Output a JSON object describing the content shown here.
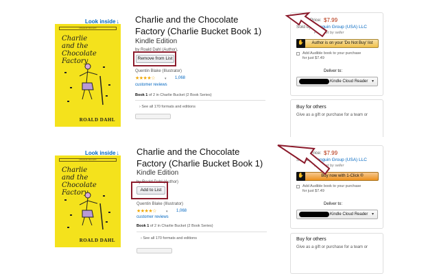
{
  "panels": [
    {
      "look_inside": "Look inside",
      "cover": {
        "band": "CHARLIE BUCKET",
        "title_lines": [
          "Charlie",
          "and the",
          "Chocolate",
          "Factory"
        ],
        "author": "ROALD DAHL"
      },
      "title_line1": "Charlie and the Chocolate",
      "title_line2": "Factory (Charlie Bucket Book 1)",
      "edition": "Kindle Edition",
      "byline": "by Roald Dahl (Author),",
      "list_button": "Remove from List",
      "illustrator": "Quentin Blake (Illustrator)",
      "stars": "★★★★☆",
      "ratings_count": "1,068",
      "reviews_label": "customer reviews",
      "series_bold": "Book 1",
      "series_rest": "of 2 in Charlie Bucket (2 Book Series)",
      "see_all": "See all 170 formats and editions",
      "buybox": {
        "price_label": "Kindle Price:",
        "price": "$7.99",
        "sold_by_label": "Sold by:",
        "seller": "Penguin Group (USA) LLC",
        "priced_by": "Price set by seller",
        "button": "Author is on your 'Do Not Buy' list",
        "audible": "Add Audible book to your purchase",
        "audible_price": "for just $7.49",
        "deliver_to": "Deliver to:",
        "device": "Kindle Cloud Reader"
      },
      "others_title": "Buy for others",
      "others_sub": "Give as a gift or purchase for a team or"
    },
    {
      "look_inside": "Look inside",
      "cover": {
        "band": "CHARLIE BUCKET",
        "title_lines": [
          "Charlie",
          "and the",
          "Chocolate",
          "Factory"
        ],
        "author": "ROALD DAHL"
      },
      "title_line1": "Charlie and the Chocolate",
      "title_line2": "Factory (Charlie Bucket Book 1)",
      "edition": "Kindle Edition",
      "byline": "by Roald Dahl (Author)",
      "list_button": "Add to List",
      "illustrator": "Quentin Blake (Illustrator)",
      "stars": "★★★★☆",
      "ratings_count": "1,068",
      "reviews_label": "customer reviews",
      "series_bold": "Book 1",
      "series_rest": "of 2 in Charlie Bucket (2 Book Series)",
      "see_all": "See all 170 formats and editions",
      "buybox": {
        "price_label": "Kindle Price:",
        "price": "$7.99",
        "sold_by_label": "Sold by:",
        "seller": "Penguin Group (USA) LLC",
        "priced_by": "Price set by seller",
        "button": "Buy now with 1-Click ®",
        "audible": "Add Audible book to your purchase",
        "audible_price": "for just $7.49",
        "deliver_to": "Deliver to:",
        "device": "Kindle Cloud Reader"
      },
      "others_title": "Buy for others",
      "others_sub": "Give as a gift or purchase for a team or"
    }
  ],
  "colors": {
    "cover": "#f4e21c",
    "highlight_box": "#8b1a2b",
    "link": "#0066c0",
    "price": "#b12704",
    "star": "#f0a600"
  },
  "icons": [
    "look-inside-arrow-icon",
    "hand-cursor-icon",
    "chevron-down-icon",
    "pointer-arrow-icon",
    "star-rating-icon"
  ]
}
